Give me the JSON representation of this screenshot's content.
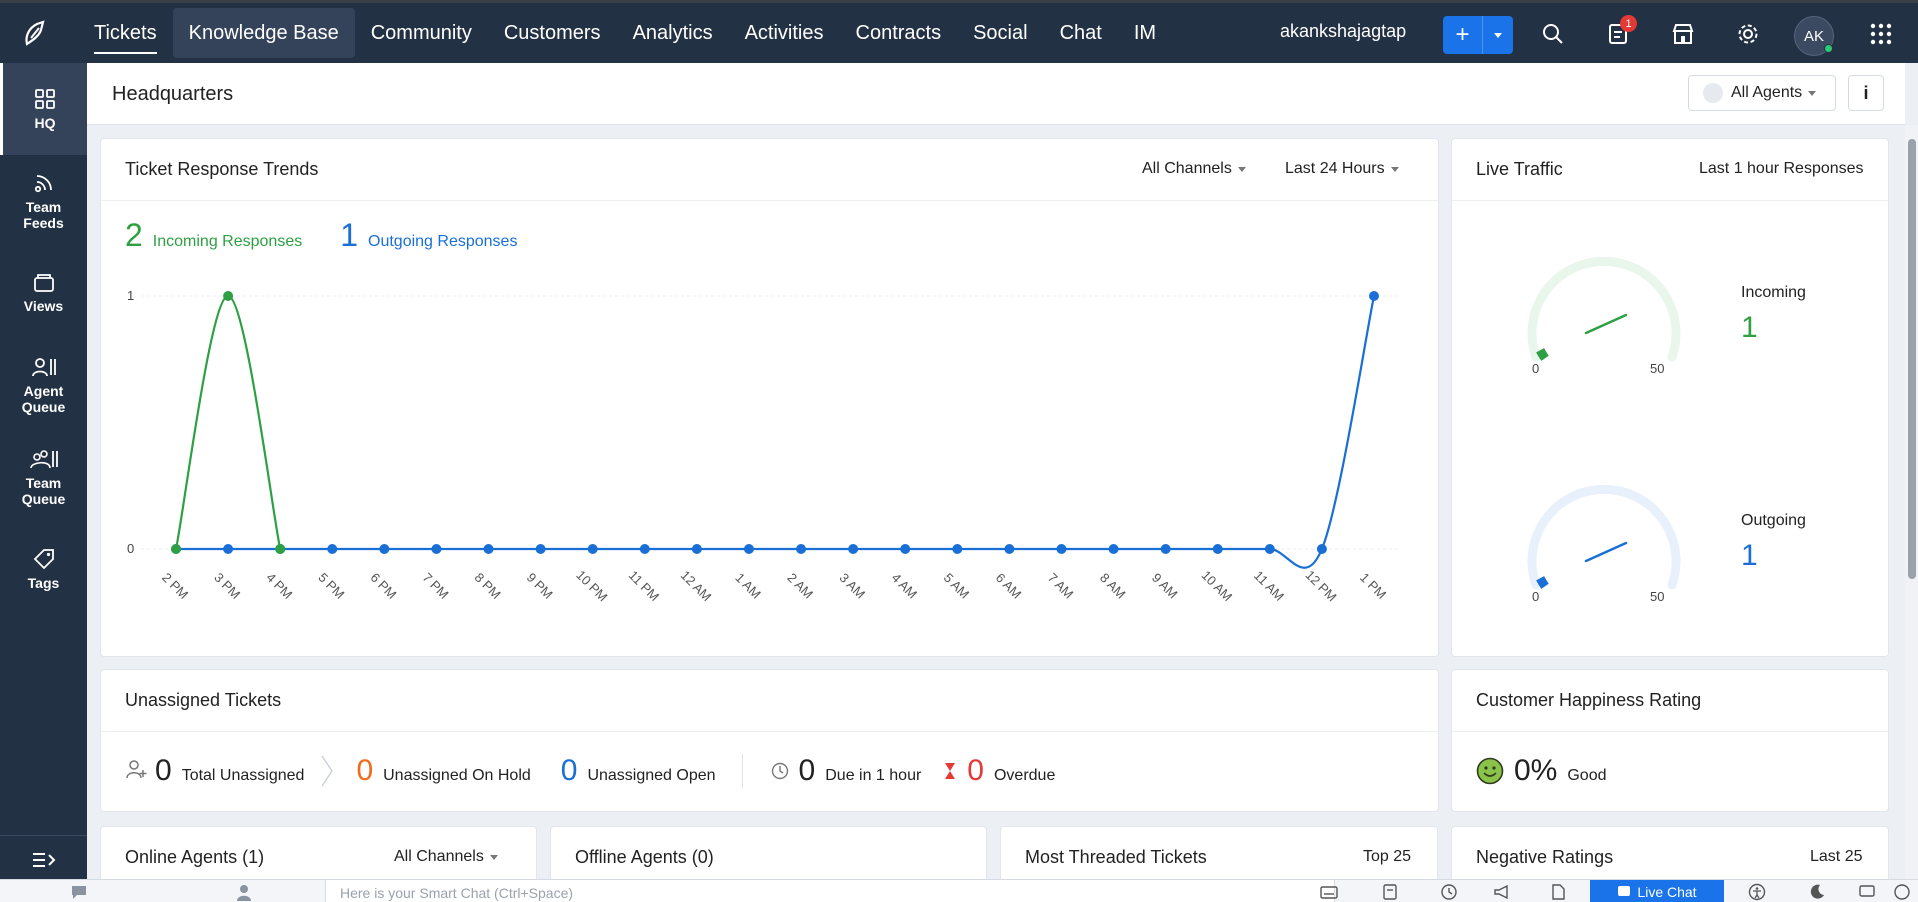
{
  "nav": {
    "tabs": [
      "Tickets",
      "Knowledge Base",
      "Community",
      "Customers",
      "Analytics",
      "Activities",
      "Contracts",
      "Social",
      "Chat",
      "IM"
    ],
    "username": "akankshajagtap",
    "notification_count": "1",
    "avatar_initials": "AK"
  },
  "sidebar": {
    "items": [
      {
        "label": "HQ"
      },
      {
        "label": "Team Feeds"
      },
      {
        "label": "Views"
      },
      {
        "label": "Agent Queue"
      },
      {
        "label": "Team Queue"
      },
      {
        "label": "Tags"
      }
    ]
  },
  "page": {
    "title": "Headquarters",
    "agents_filter": "All Agents",
    "info_label": "i"
  },
  "trends": {
    "title": "Ticket Response Trends",
    "channel_filter": "All Channels",
    "time_filter": "Last 24 Hours",
    "incoming_count": "2",
    "incoming_label": "Incoming Responses",
    "outgoing_count": "1",
    "outgoing_label": "Outgoing Responses"
  },
  "chart_data": {
    "type": "line",
    "x": [
      "2 PM",
      "3 PM",
      "4 PM",
      "5 PM",
      "6 PM",
      "7 PM",
      "8 PM",
      "9 PM",
      "10 PM",
      "11 PM",
      "12 AM",
      "1 AM",
      "2 AM",
      "3 AM",
      "4 AM",
      "5 AM",
      "6 AM",
      "7 AM",
      "8 AM",
      "9 AM",
      "10 AM",
      "11 AM",
      "12 PM",
      "1 PM"
    ],
    "series": [
      {
        "name": "Incoming Responses",
        "color": "#2ea043",
        "values": [
          0,
          1,
          0,
          null,
          null,
          null,
          null,
          null,
          null,
          null,
          null,
          null,
          null,
          null,
          null,
          null,
          null,
          null,
          null,
          null,
          null,
          null,
          null,
          null
        ]
      },
      {
        "name": "Outgoing Responses",
        "color": "#1a6fd6",
        "values": [
          0,
          0,
          0,
          0,
          0,
          0,
          0,
          0,
          0,
          0,
          0,
          0,
          0,
          0,
          0,
          0,
          0,
          0,
          0,
          0,
          0,
          0,
          0,
          1
        ]
      }
    ],
    "y_ticks": [
      "0",
      "1"
    ],
    "ylim": [
      0,
      1
    ],
    "grid": true
  },
  "traffic": {
    "title": "Live Traffic",
    "subtitle": "Last 1 hour Responses",
    "incoming_label": "Incoming",
    "incoming_value": "1",
    "outgoing_label": "Outgoing",
    "outgoing_value": "1",
    "gauge_min": "0",
    "gauge_max": "50",
    "incoming_color": "#2ea043",
    "outgoing_color": "#1a6fd6"
  },
  "unassigned": {
    "title": "Unassigned Tickets",
    "stats": [
      {
        "value": "0",
        "label": "Total Unassigned"
      },
      {
        "value": "0",
        "label": "Unassigned On Hold"
      },
      {
        "value": "0",
        "label": "Unassigned Open"
      },
      {
        "value": "0",
        "label": "Due in 1 hour"
      },
      {
        "value": "0",
        "label": "Overdue"
      }
    ]
  },
  "happiness": {
    "title": "Customer Happiness Rating",
    "value": "0%",
    "label": "Good"
  },
  "bottom_cards": {
    "online_title": "Online Agents (1)",
    "online_filter": "All Channels",
    "offline_title": "Offline Agents (0)",
    "threaded_title": "Most Threaded Tickets",
    "threaded_filter": "Top 25",
    "negative_title": "Negative Ratings",
    "negative_filter": "Last 25"
  },
  "bottombar": {
    "chat_placeholder": "Here is your Smart Chat (Ctrl+Space)",
    "live_chat": "Live Chat"
  }
}
